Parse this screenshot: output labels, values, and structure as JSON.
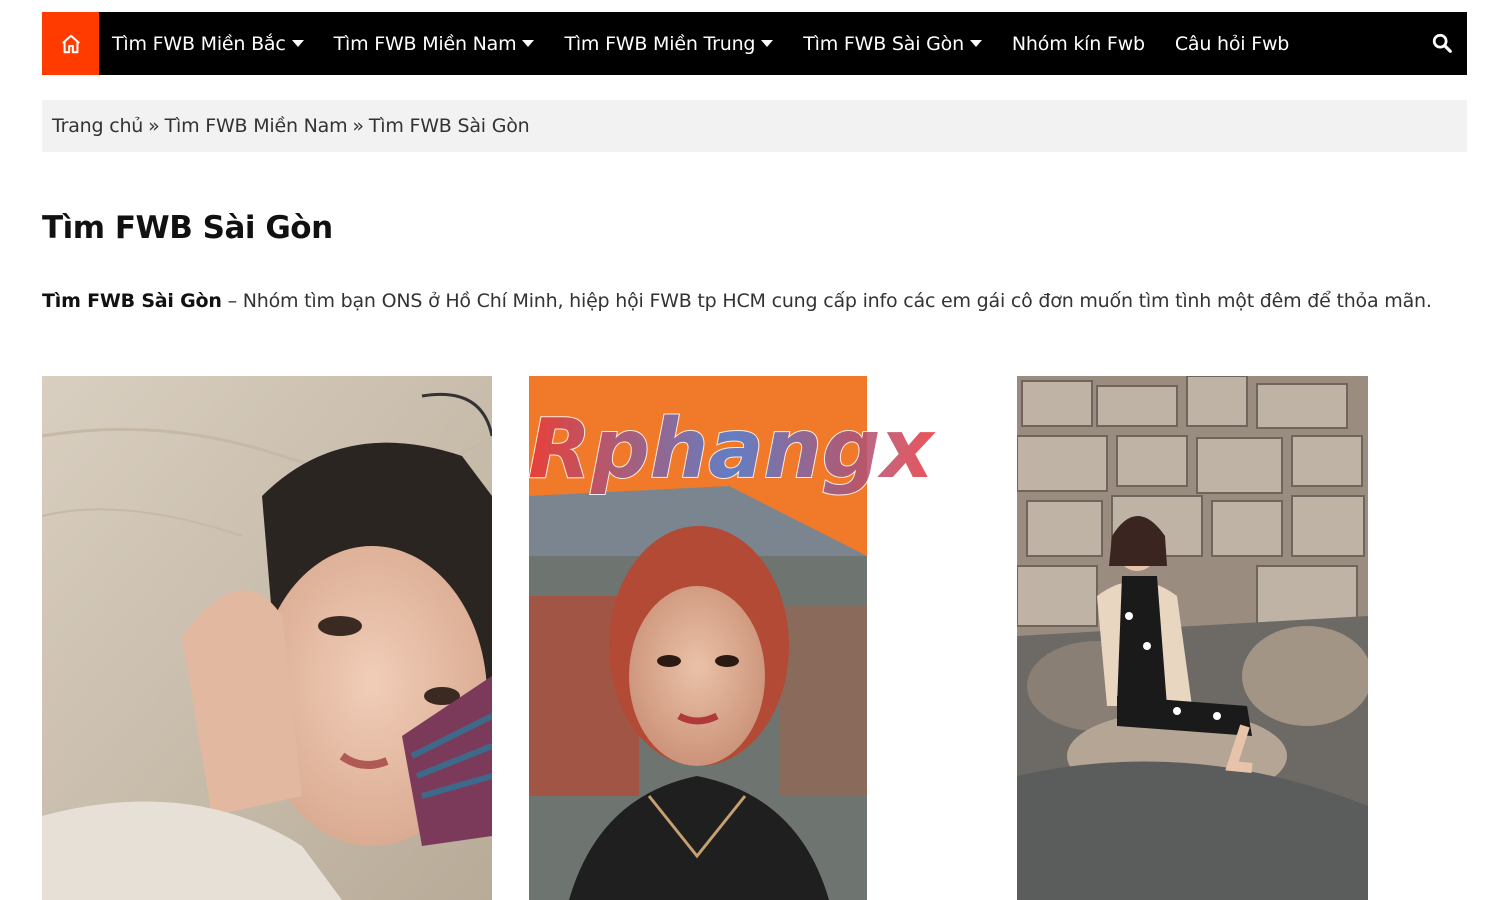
{
  "nav": {
    "items": [
      {
        "label": "Tìm FWB Miền Bắc",
        "dropdown": true
      },
      {
        "label": "Tìm FWB Miền Nam",
        "dropdown": true
      },
      {
        "label": "Tìm FWB Miền Trung",
        "dropdown": true
      },
      {
        "label": "Tìm FWB Sài Gòn",
        "dropdown": true
      },
      {
        "label": "Nhóm kín Fwb",
        "dropdown": false
      },
      {
        "label": "Câu hỏi Fwb",
        "dropdown": false
      }
    ],
    "home_icon": "home-icon",
    "search_icon": "search-icon",
    "accent": "#ff3b00"
  },
  "breadcrumb": {
    "home": "Trang chủ",
    "separator": "»",
    "parent": "Tìm FWB Miền Nam",
    "current": "Tìm FWB Sài Gòn"
  },
  "page": {
    "title": "Tìm FWB Sài Gòn",
    "intro_bold": "Tìm FWB Sài Gòn",
    "intro_text": " – Nhóm tìm bạn ONS ở Hồ Chí Minh, hiệp hội FWB tp HCM cung cấp info các em gái cô đơn muốn tìm tình một đêm để thỏa mãn."
  },
  "watermark": {
    "text": "Rphangx"
  }
}
